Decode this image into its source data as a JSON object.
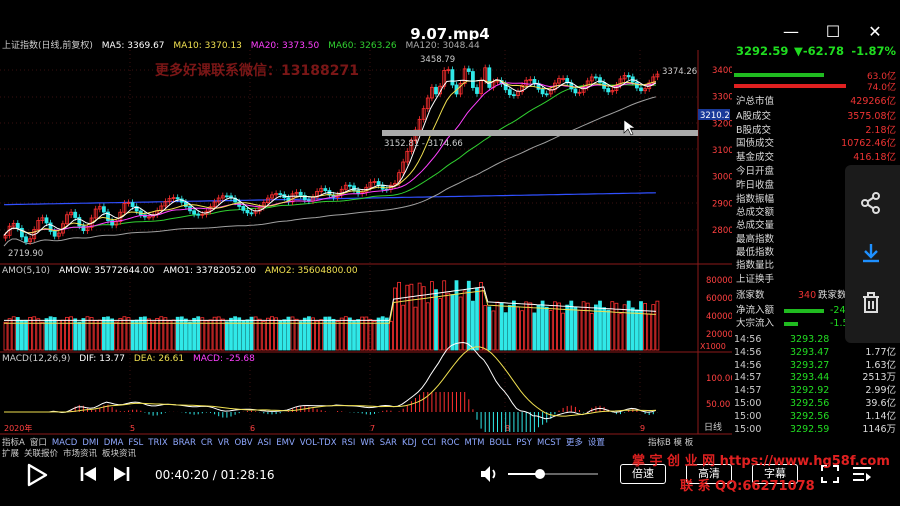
{
  "window": {
    "title": "9.07.mp4",
    "minimize": "—",
    "maximize": "☐",
    "close": "✕"
  },
  "chart": {
    "main_legend": {
      "name": "上证指数(日线,前复权)",
      "ma5": "MA5: 3369.67",
      "ma10": "MA10: 3370.13",
      "ma20": "MA20: 3373.50",
      "ma60": "MA60: 3263.26",
      "ma120": "MA120: 3048.44"
    },
    "price_labels": {
      "high": "3458.79",
      "last": "3374.26",
      "low": "2719.90",
      "gap_range": "3152.81 - 3174.66",
      "cursor_price": "3210.2"
    },
    "y_axis": [
      "3400",
      "3300",
      "3200",
      "3100",
      "3000",
      "2900",
      "2800"
    ],
    "x_axis": [
      "2020年",
      "5",
      "6",
      "7",
      "8",
      "9"
    ],
    "amo_legend": {
      "name": "AMO(5,10)",
      "amow": "AMOW: 35772644.00",
      "amo1": "AMO1: 33782052.00",
      "amo2": "AMO2: 35604800.00"
    },
    "amo_axis": [
      "80000",
      "60000",
      "40000",
      "20000"
    ],
    "amo_unit": "X1000",
    "macd_legend": {
      "name": "MACD(12,26,9)",
      "dif": "DIF: 13.77",
      "dea": "DEA: 26.61",
      "macd": "MACD: -25.68"
    },
    "macd_axis": [
      "100.00",
      "50.00"
    ],
    "period": "日线"
  },
  "colors": {
    "up": "#ff3030",
    "down": "#30e8e8",
    "ma5": "#ffffff",
    "ma10": "#f0e050",
    "ma20": "#ff40ff",
    "ma60": "#30d030",
    "ma120": "#a0a0a0",
    "ma250": "#3050ff",
    "green_text": "#20dd20",
    "red_text": "#ff3030"
  },
  "quote": {
    "price": "3292.59",
    "change": "▼-62.78",
    "change_pct": "-1.87%",
    "buy_amt": "63.0亿",
    "sell_amt": "74.0亿",
    "rows": [
      {
        "label": "沪总市值",
        "value": "429266亿"
      },
      {
        "label": "A股成交",
        "value": "3575.08亿"
      },
      {
        "label": "B股成交",
        "value": "2.18亿"
      },
      {
        "label": "国债成交",
        "value": "10762.46亿"
      },
      {
        "label": "基金成交",
        "value": "416.18亿"
      },
      {
        "label": "今日开盘",
        "value": "3319.83"
      },
      {
        "label": "昨日收盘",
        "value": "3355.37"
      },
      {
        "label": "指数振幅",
        "value": "1.44%"
      },
      {
        "label": "总成交额",
        "value": "3575.1亿"
      },
      {
        "label": "总成交量",
        "value": "260616万"
      },
      {
        "label": "最高指数",
        "value": "3344.97"
      },
      {
        "label": "最低指数",
        "value": "3292.59"
      },
      {
        "label": "指数量比",
        "value": "0.98"
      },
      {
        "label": "上证换手",
        "value": "0.71%"
      }
    ],
    "rise_label": "涨家数",
    "rise_value": "340",
    "fall_label": "跌家数",
    "net_inflow_label": "净流入额",
    "net_inflow_value": "-24",
    "block_inflow_label": "大宗流入",
    "block_inflow_value": "-1.53",
    "ticks": [
      {
        "t": "14:56",
        "p": "3293.28",
        "v": "2.25亿"
      },
      {
        "t": "14:56",
        "p": "3293.47",
        "v": "1.77亿"
      },
      {
        "t": "14:56",
        "p": "3293.27",
        "v": "1.63亿"
      },
      {
        "t": "14:57",
        "p": "3293.44",
        "v": "2513万"
      },
      {
        "t": "14:57",
        "p": "3292.92",
        "v": "2.99亿"
      },
      {
        "t": "15:00",
        "p": "3292.56",
        "v": "39.6亿"
      },
      {
        "t": "15:00",
        "p": "3292.56",
        "v": "1.14亿"
      },
      {
        "t": "15:00",
        "p": "3292.59",
        "v": "1146万"
      }
    ]
  },
  "tabs": [
    "指标A",
    "窗口",
    "MACD",
    "DMI",
    "DMA",
    "FSL",
    "TRIX",
    "BRAR",
    "CR",
    "VR",
    "OBV",
    "ASI",
    "EMV",
    "VOL-TDX",
    "RSI",
    "WR",
    "SAR",
    "KDJ",
    "CCI",
    "ROC",
    "MTM",
    "BOLL",
    "PSY",
    "MCST",
    "更多",
    "设置"
  ],
  "tabs_right": "指标B 模 板",
  "sub_tabs": [
    "扩展",
    "关联报价",
    "市场资讯",
    "板块资讯"
  ],
  "player": {
    "current_time": "00:40:20",
    "duration": "01:28:16",
    "time_sep": " / ",
    "speed_label": "倍速",
    "quality_label": "高清",
    "subtitle_label": "字幕",
    "volume_level": 0.35
  },
  "watermarks": {
    "wechat": "更多好课联系微信：13188271",
    "site_line": "掌 宇 创 业 网 https://www.hg58f.com",
    "qq_line": "联 系 QQ:66271078"
  },
  "icons": [
    "share-icon",
    "download-icon",
    "trash-icon",
    "play-icon",
    "prev-icon",
    "next-icon",
    "volume-icon",
    "fullscreen-icon",
    "playlist-icon"
  ]
}
